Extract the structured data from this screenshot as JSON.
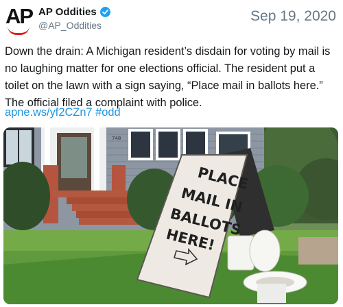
{
  "account": {
    "display_name": "AP Oddities",
    "handle": "@AP_Oddities",
    "avatar_text": "AP"
  },
  "tweet": {
    "date": "Sep 19, 2020",
    "text": "Down the drain: A Michigan resident’s disdain for voting by mail is no laughing matter for one elections official. The resident put a toilet on the lawn with a sign saying, “Place mail in ballots here.” The official filed a complaint with police.",
    "link": "apne.ws/yf2CZn7",
    "hashtag": "#odd"
  },
  "media": {
    "sign_lines": [
      "PLACE",
      "MAIL IN",
      "BALLOTS",
      "HERE!"
    ],
    "house_number": "748",
    "icons": [
      "verified-badge-icon",
      "arrow-right-icon"
    ]
  },
  "colors": {
    "link": "#1b95e0",
    "muted": "#657786",
    "verified": "#1da1f2",
    "ap_red": "#e11d1d"
  }
}
